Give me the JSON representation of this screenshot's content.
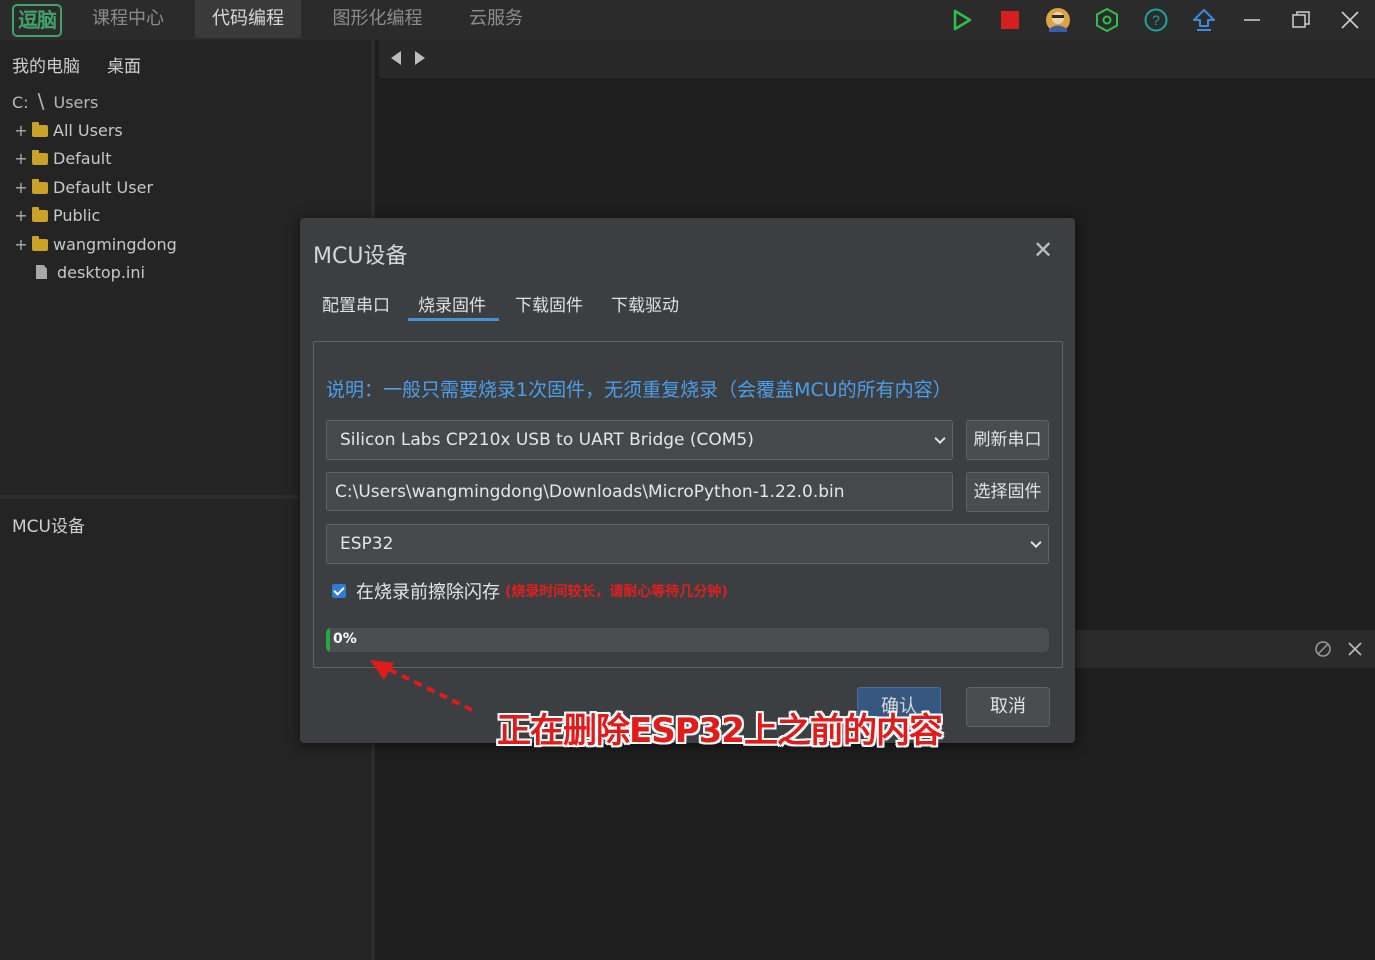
{
  "app": {
    "logo": "逗脑",
    "menu": [
      "课程中心",
      "代码编程",
      "图形化编程",
      "云服务"
    ],
    "active_menu": "代码编程",
    "toolbar_icons": [
      "run-icon",
      "stop-icon",
      "user-avatar-icon",
      "settings-hex-icon",
      "help-icon",
      "upload-icon",
      "minimize-icon",
      "restore-icon",
      "close-icon"
    ],
    "colors": {
      "run": "#2fbf4a",
      "stop": "#d61f1f",
      "accent": "#4a8fd4",
      "warning": "#e01f1f",
      "progress": "#29a744"
    }
  },
  "sidebar": {
    "location_tabs": [
      "我的电脑",
      "桌面"
    ],
    "path": {
      "drive": "C:",
      "sep": "\\",
      "folder": "Users"
    },
    "tree": [
      {
        "label": "All Users",
        "type": "folder"
      },
      {
        "label": "Default",
        "type": "folder"
      },
      {
        "label": "Default User",
        "type": "folder"
      },
      {
        "label": "Public",
        "type": "folder"
      },
      {
        "label": "wangmingdong",
        "type": "folder"
      },
      {
        "label": "desktop.ini",
        "type": "file"
      }
    ],
    "section_title": "MCU设备"
  },
  "dialog": {
    "title": "MCU设备",
    "tabs": [
      "配置串口",
      "烧录固件",
      "下载固件",
      "下载驱动"
    ],
    "active_tab": "烧录固件",
    "description": "说明：一般只需要烧录1次固件，无须重复烧录（会覆盖MCU的所有内容）",
    "port_select": "Silicon Labs CP210x USB to UART Bridge (COM5)",
    "refresh_button": "刷新串口",
    "firmware_path": "C:\\Users\\wangmingdong\\Downloads\\MicroPython-1.22.0.bin",
    "choose_button": "选择固件",
    "chip_select": "ESP32",
    "erase_checked": true,
    "erase_label": "在烧录前擦除闪存",
    "erase_warning": "(烧录时间较长，请耐心等待几分钟)",
    "progress_value": 0,
    "progress_text": "0%",
    "ok_button": "确认",
    "cancel_button": "取消"
  },
  "annotation": {
    "text": "正在删除ESP32上之前的内容",
    "color": "#e11a1a"
  }
}
